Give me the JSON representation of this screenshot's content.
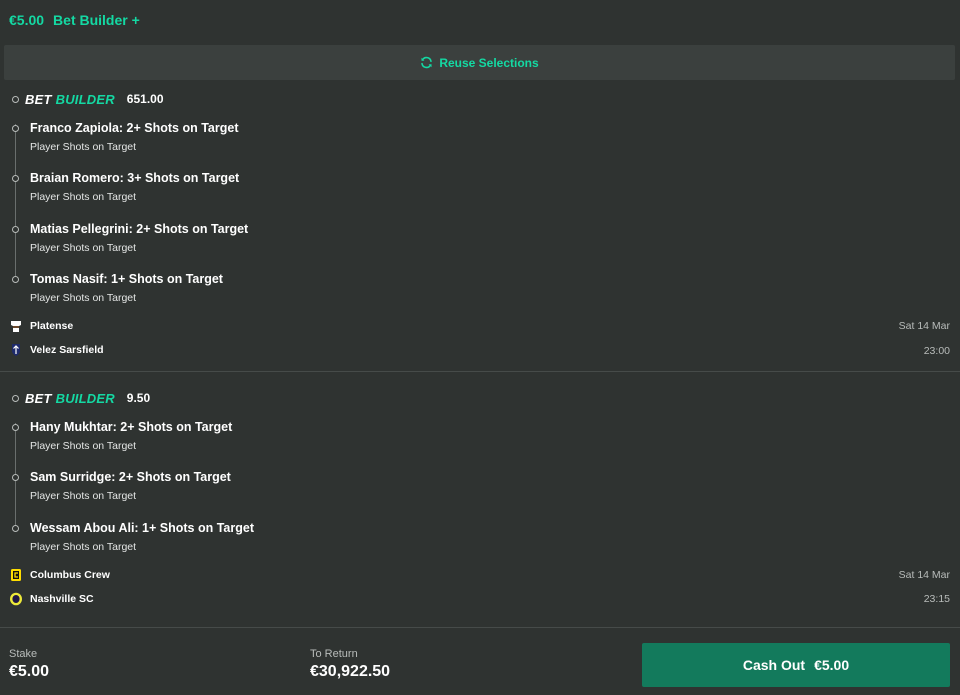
{
  "header": {
    "stake": "€5.00",
    "bet_type": "Bet Builder +"
  },
  "reuse": {
    "label": "Reuse Selections"
  },
  "builders": [
    {
      "logo_white": "BET",
      "logo_green": "BUILDER",
      "odds": "651.00",
      "selections": [
        {
          "title": "Franco Zapiola: 2+ Shots on Target",
          "market": "Player Shots on Target"
        },
        {
          "title": "Braian Romero: 3+ Shots on Target",
          "market": "Player Shots on Target"
        },
        {
          "title": "Matias Pellegrini: 2+ Shots on Target",
          "market": "Player Shots on Target"
        },
        {
          "title": "Tomas Nasif: 1+ Shots on Target",
          "market": "Player Shots on Target"
        }
      ],
      "teams": [
        "Platense",
        "Velez Sarsfield"
      ],
      "date": "Sat 14 Mar",
      "time": "23:00"
    },
    {
      "logo_white": "BET",
      "logo_green": "BUILDER",
      "odds": "9.50",
      "selections": [
        {
          "title": "Hany Mukhtar: 2+ Shots on Target",
          "market": "Player Shots on Target"
        },
        {
          "title": "Sam Surridge: 2+ Shots on Target",
          "market": "Player Shots on Target"
        },
        {
          "title": "Wessam Abou Ali: 1+ Shots on Target",
          "market": "Player Shots on Target"
        }
      ],
      "teams": [
        "Columbus Crew",
        "Nashville SC"
      ],
      "date": "Sat 14 Mar",
      "time": "23:15"
    }
  ],
  "footer": {
    "stake_label": "Stake",
    "stake_value": "€5.00",
    "return_label": "To Return",
    "return_value": "€30,922.50",
    "cashout_label": "Cash Out",
    "cashout_amount": "€5.00"
  },
  "colors": {
    "accent": "#14d9a3",
    "background": "#2f3331",
    "cashout": "#137a5c"
  },
  "icons": [
    "refresh-icon",
    "platense-crest-icon",
    "velez-crest-icon",
    "columbus-crest-icon",
    "nashville-crest-icon"
  ]
}
